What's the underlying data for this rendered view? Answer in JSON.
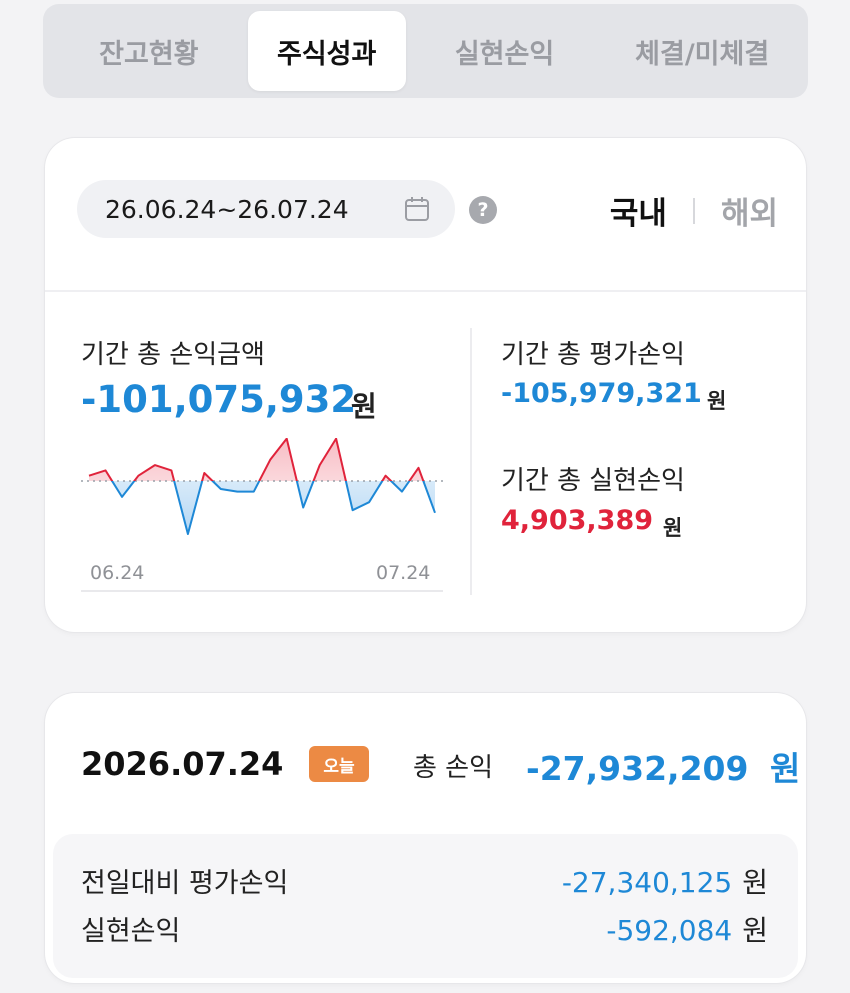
{
  "tabs": [
    {
      "label": "잔고현황"
    },
    {
      "label": "주식성과"
    },
    {
      "label": "실현손익"
    },
    {
      "label": "체결/미체결"
    }
  ],
  "period": {
    "date_range": "26.06.24~26.07.24",
    "calendar_icon": "calendar-icon",
    "help_icon": "?",
    "region_selected": "국내",
    "region_other": "해외"
  },
  "summary": {
    "total_pl_label": "기간 총 손익금액",
    "total_pl_value": "-101,075,932",
    "unit": "원",
    "eval_pl_label": "기간 총 평가손익",
    "eval_pl_value": "-105,979,321",
    "realized_pl_label": "기간 총 실현손익",
    "realized_pl_value": "4,903,389",
    "colors": {
      "negative": "#1e88d6",
      "positive": "#e0233b"
    }
  },
  "chart_data": {
    "type": "line",
    "x_start_label": "06.24",
    "x_end_label": "07.24",
    "baseline": 0,
    "values": [
      2,
      4,
      -6,
      2,
      6,
      4,
      -20,
      3,
      -3,
      -4,
      -4,
      8,
      16,
      -10,
      6,
      16,
      -11,
      -8,
      2,
      -4,
      5,
      -12
    ]
  },
  "daily": {
    "date": "2026.07.24",
    "badge": "오늘",
    "total_label": "총 손익",
    "total_value": "-27,932,209",
    "unit": "원",
    "rows": [
      {
        "label": "전일대비 평가손익",
        "value": "-27,340,125"
      },
      {
        "label": "실현손익",
        "value": "-592,084"
      }
    ]
  }
}
